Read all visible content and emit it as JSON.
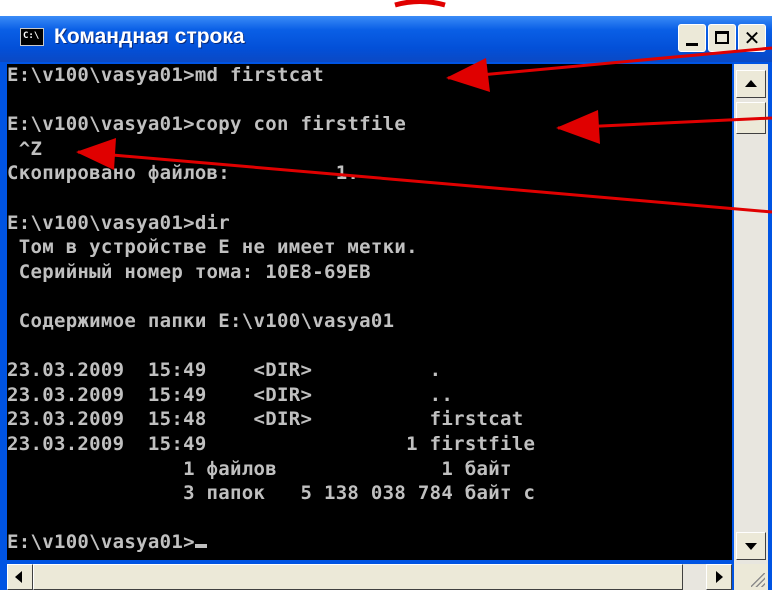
{
  "window": {
    "title": "Командная строка",
    "icon": "C:\\",
    "icon_name": "cmd-icon",
    "controls": [
      "minimize-icon",
      "maximize-icon",
      "close-icon"
    ],
    "close_glyph": "✕"
  },
  "console": {
    "lines": [
      "E:\\v100\\vasya01>md firstcat",
      "",
      "E:\\v100\\vasya01>copy con firstfile",
      " ^Z",
      "Скопировано файлов:         1.",
      "",
      "E:\\v100\\vasya01>dir",
      " Том в устройстве E не имеет метки.",
      " Серийный номер тома: 10E8-69EB",
      "",
      " Содержимое папки E:\\v100\\vasya01",
      "",
      "23.03.2009  15:49    <DIR>          .",
      "23.03.2009  15:49    <DIR>          ..",
      "23.03.2009  15:48    <DIR>          firstcat",
      "23.03.2009  15:49                 1 firstfile",
      "               1 файлов              1 байт",
      "               3 папок   5 138 038 784 байт с",
      "",
      "E:\\v100\\vasya01>"
    ],
    "text_color": "#c0c0c0",
    "background": "#000000"
  },
  "colors": {
    "titlebar": "#0054e3",
    "annotation_arrow": "#e00000"
  }
}
